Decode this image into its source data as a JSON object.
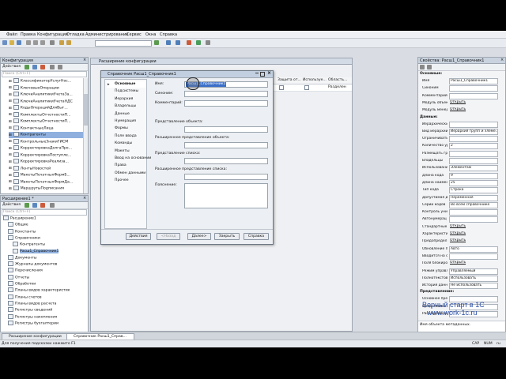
{
  "menu": [
    "Файл",
    "Правка",
    "Конфигурация",
    "Отладка",
    "Администрирование",
    "Сервис",
    "Окна",
    "Справка"
  ],
  "left_top": {
    "title": "Конфигурация",
    "actions_label": "Действия",
    "search_placeholder": "Поиск (Ctrl+F)",
    "items": [
      "КлассификаторУслугНос...",
      "КлючевыеОперации",
      "КлючиАналитикиУчетаЗа...",
      "КлючиАналитикиУчетаНДС",
      "КодыОперацийДляВыг...",
      "КомплектыОтчетностиП...",
      "КомплектыОтчетностиП...",
      "КонтактныеЛица",
      "Контрагенты",
      "КонтрольныеЗнакиГИСМ",
      "КорректировкаДолгаПро...",
      "КорректировкаПоступле...",
      "КорректировкаРеализа...",
      "ЛентыНовостей",
      "МакетыПечатныхФормБ...",
      "МакетыПечатныхФормДа...",
      "МаршрутыПодписания"
    ],
    "selected_index": 8
  },
  "left_bottom": {
    "title": "Расширение1 *",
    "actions_label": "Действия",
    "search_placeholder": "Поиск (Ctrl+F)",
    "items": [
      {
        "label": "Расширение1",
        "indent": 0
      },
      {
        "label": "Общие",
        "indent": 1
      },
      {
        "label": "Константы",
        "indent": 1
      },
      {
        "label": "Справочники",
        "indent": 1
      },
      {
        "label": "Контрагенты",
        "indent": 2
      },
      {
        "label": "Расш1_Справочник1",
        "indent": 2,
        "selected": true
      },
      {
        "label": "Документы",
        "indent": 1
      },
      {
        "label": "Журналы документов",
        "indent": 1
      },
      {
        "label": "Перечисления",
        "indent": 1
      },
      {
        "label": "Отчеты",
        "indent": 1
      },
      {
        "label": "Обработки",
        "indent": 1
      },
      {
        "label": "Планы видов характеристик",
        "indent": 1
      },
      {
        "label": "Планы счетов",
        "indent": 1
      },
      {
        "label": "Планы видов расчета",
        "indent": 1
      },
      {
        "label": "Регистры сведений",
        "indent": 1
      },
      {
        "label": "Регистры накопления",
        "indent": 1
      },
      {
        "label": "Регистры бухгалтерии",
        "indent": 1
      }
    ]
  },
  "ext_window": {
    "title": "Расширение конфигурации",
    "columns": [
      "Защита от...",
      "Используе...",
      "Область..."
    ],
    "row_value": "Разделен"
  },
  "dialog": {
    "title": "Справочник Расш1_Справочник1",
    "tabs": [
      "Основные",
      "Подсистемы",
      "Иерархия",
      "Владельцы",
      "Данные",
      "Нумерация",
      "Формы",
      "Поле ввода",
      "Команды",
      "Макеты",
      "Ввод на основании",
      "Права",
      "Обмен данными",
      "Прочее"
    ],
    "fields": {
      "name_label": "Имя:",
      "name_value": "Расш1_Справочник1",
      "synonym_label": "Синоним:",
      "comment_label": "Комментарий:",
      "object_repr_label": "Представление объекта:",
      "ext_object_repr_label": "Расширенное представление объекта:",
      "list_repr_label": "Представление списка:",
      "ext_list_repr_label": "Расширенное представление списка:",
      "explanation_label": "Пояснение:"
    },
    "buttons": {
      "actions": "Действия",
      "back": "<Назад",
      "next": "Далее>",
      "close": "Закрыть",
      "help": "Справка"
    }
  },
  "properties": {
    "title": "Свойства: Расш1_Справочник1",
    "section_main": "Основные:",
    "rows": [
      {
        "label": "Имя",
        "value": "Расш1_Справочник1"
      },
      {
        "label": "Синоним",
        "value": ""
      },
      {
        "label": "Комментарий",
        "value": ""
      },
      {
        "label": "Модуль объект",
        "value": "Открыть"
      },
      {
        "label": "Модуль менедж",
        "value": "Открыть"
      }
    ],
    "section_data": "Данные:",
    "data_rows": [
      {
        "label": "Иерархически",
        "value": ""
      },
      {
        "label": "Вид иерархии",
        "value": "Иерархия групп и элеме..."
      },
      {
        "label": "Ограничивать",
        "value": ""
      },
      {
        "label": "Количество ур",
        "value": "2"
      },
      {
        "label": "Размещать гр",
        "value": ""
      },
      {
        "label": "Владельцы",
        "value": ""
      },
      {
        "label": "Использовани",
        "value": "Элементам"
      },
      {
        "label": "Длина кода",
        "value": "9"
      },
      {
        "label": "Длина наимен",
        "value": "25"
      },
      {
        "label": "Тип кода",
        "value": "Строка"
      },
      {
        "label": "Допустимая д",
        "value": "Переменная"
      },
      {
        "label": "Серии кодов",
        "value": "Во всем справочнике"
      },
      {
        "label": "Контроль уник",
        "value": ""
      },
      {
        "label": "Автонумерац",
        "value": ""
      },
      {
        "label": "Стандартные",
        "value": "Открыть"
      },
      {
        "label": "Характеристи",
        "value": "Открыть"
      },
      {
        "label": "Предопредел",
        "value": "Открыть"
      },
      {
        "label": "Обновление п",
        "value": "Авто"
      },
      {
        "label": "Вводится на с",
        "value": ""
      },
      {
        "label": "Поля блокиро",
        "value": "Открыть"
      },
      {
        "label": "Режим управл",
        "value": "Управляемый"
      },
      {
        "label": "Полнотекстов",
        "value": "Использовать"
      },
      {
        "label": "История данн",
        "value": "Не использовать"
      }
    ],
    "section_repr": "Представление:",
    "repr_rows": [
      {
        "label": "Основное пре",
        "value": ""
      },
      {
        "label": "Представлен",
        "value": ""
      },
      {
        "label": "Расширенное",
        "value": ""
      }
    ],
    "hint": "Имя объекта метаданных."
  },
  "watermark": {
    "line1": "Верный старт в 1С",
    "line2": "www.work-1c.ru"
  },
  "taskbar": [
    "Расширение конфигурации",
    "Справочник Расш1_Справ..."
  ],
  "status": {
    "hint": "Для получения подсказки нажмите F1",
    "cap": "CAP",
    "num": "NUM",
    "lang": "ru"
  }
}
